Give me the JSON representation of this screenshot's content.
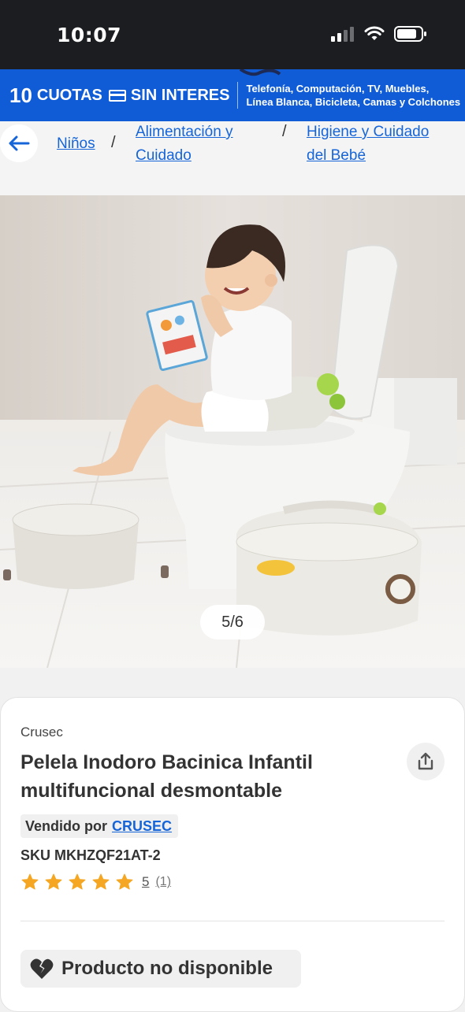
{
  "status_bar": {
    "time": "10:07"
  },
  "promo": {
    "number": "10",
    "left_text_1": "CUOTAS",
    "left_text_2": "SIN INTERES",
    "right_line_1": "Telefonía, Computación, TV, Muebles,",
    "right_line_2": "Línea Blanca, Bicicleta, Camas y Colchones"
  },
  "breadcrumb": {
    "items": [
      {
        "label": "Niños"
      },
      {
        "label_line_1": "Alimentación y",
        "label_line_2": "Cuidado"
      },
      {
        "label_line_1": "Higiene y Cuidado",
        "label_line_2": "del Bebé"
      }
    ],
    "separator": "/"
  },
  "gallery": {
    "pager": "5/6"
  },
  "product": {
    "brand": "Crusec",
    "title": "Pelela Inodoro Bacinica Infantil multifuncional desmontable",
    "sold_by_label": "Vendido por",
    "seller": "CRUSEC",
    "sku": "SKU MKHZQF21AT-2",
    "rating": 5,
    "rating_value": "5",
    "rating_count": "(1)",
    "star_color": "#f5a623",
    "unavailable_label": "Producto no disponible"
  },
  "colors": {
    "brand_blue": "#0f5cd6",
    "link_blue": "#1565d8"
  }
}
